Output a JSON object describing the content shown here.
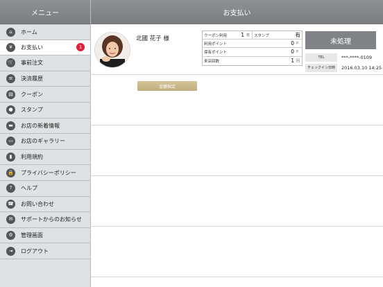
{
  "sidebar": {
    "title": "メニュー",
    "items": [
      {
        "label": "ホーム",
        "icon": "home-icon",
        "glyph": "⌂"
      },
      {
        "label": "お支払い",
        "icon": "wallet-icon",
        "glyph": "¥",
        "badge": "1"
      },
      {
        "label": "事前注文",
        "icon": "cart-icon",
        "glyph": "🛒"
      },
      {
        "label": "決済履歴",
        "icon": "history-icon",
        "glyph": "≡"
      },
      {
        "label": "クーポン",
        "icon": "coupon-icon",
        "glyph": "▤"
      },
      {
        "label": "スタンプ",
        "icon": "stamp-icon",
        "glyph": "●"
      },
      {
        "label": "お店の新着情報",
        "icon": "news-icon",
        "glyph": "▬"
      },
      {
        "label": "お店のギャラリー",
        "icon": "gallery-icon",
        "glyph": "▭"
      },
      {
        "label": "利用規約",
        "icon": "terms-icon",
        "glyph": "▮"
      },
      {
        "label": "プライバシーポリシー",
        "icon": "lock-icon",
        "glyph": "🔒"
      },
      {
        "label": "ヘルプ",
        "icon": "help-icon",
        "glyph": "?"
      },
      {
        "label": "お問い合わせ",
        "icon": "phone-icon",
        "glyph": "☎"
      },
      {
        "label": "サポートからのお知らせ",
        "icon": "notice-icon",
        "glyph": "✉"
      },
      {
        "label": "管理画面",
        "icon": "gear-icon",
        "glyph": "⚙"
      },
      {
        "label": "ログアウト",
        "icon": "logout-icon",
        "glyph": "⇥"
      }
    ]
  },
  "header": {
    "title": "お支払い"
  },
  "customer": {
    "name": "北國 花子 様",
    "amount_button": "金額指定",
    "coupon_label": "クーポン利用",
    "coupon_value": "1",
    "coupon_unit": "枚",
    "stamp_label": "スタンプ",
    "stamp_value": "有",
    "used_points_label": "利用ポイント",
    "used_points_value": "0",
    "used_points_unit": "P",
    "held_points_label": "保有ポイント",
    "held_points_value": "0",
    "held_points_unit": "P",
    "visits_label": "来店回数",
    "visits_value": "1",
    "visits_unit": "回"
  },
  "status": {
    "button_label": "未処理",
    "tel_label": "TEL",
    "tel_value": "***-****-0109",
    "checkin_label": "チェックイン日時",
    "checkin_value": "2016.03.10 14:25"
  },
  "colors": {
    "header_gray": "#7f8388",
    "badge_red": "#e0203a",
    "gold_button": "#c9b98a"
  }
}
